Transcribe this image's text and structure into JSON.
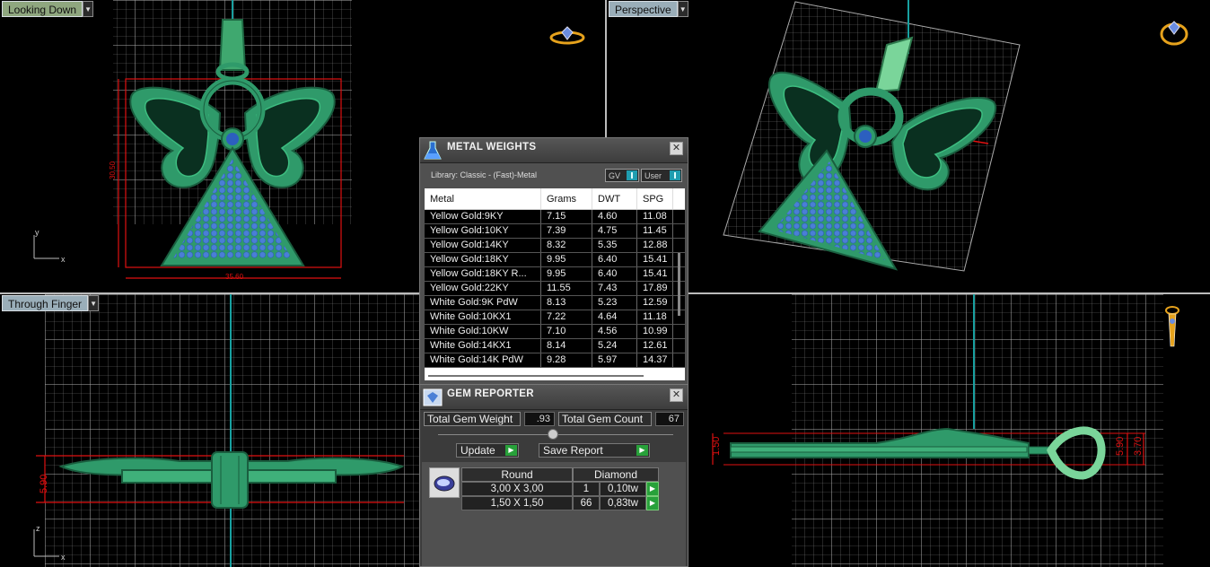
{
  "viewports": {
    "top": {
      "label": "Looking Down",
      "dim_width": "35.60",
      "dim_height": "30.50",
      "axis_a": "y",
      "axis_b": "x"
    },
    "perspective": {
      "label": "Perspective"
    },
    "finger": {
      "label": "Through Finger",
      "dim_height": "5.90",
      "axis_a": "z",
      "axis_b": "x"
    },
    "side": {
      "dim_left": "1.50",
      "dim_mid": "5.90",
      "dim_right": "3.70"
    }
  },
  "metal_weights": {
    "title": "METAL WEIGHTS",
    "library": "Library: Classic - (Fast)-Metal",
    "toggle_gv": "GV",
    "toggle_user": "User",
    "columns": [
      "Metal",
      "Grams",
      "DWT",
      "SPG"
    ],
    "rows": [
      {
        "metal": "Yellow Gold:9KY",
        "grams": "7.15",
        "dwt": "4.60",
        "spg": "11.08"
      },
      {
        "metal": "Yellow Gold:10KY",
        "grams": "7.39",
        "dwt": "4.75",
        "spg": "11.45"
      },
      {
        "metal": "Yellow Gold:14KY",
        "grams": "8.32",
        "dwt": "5.35",
        "spg": "12.88"
      },
      {
        "metal": "Yellow Gold:18KY",
        "grams": "9.95",
        "dwt": "6.40",
        "spg": "15.41"
      },
      {
        "metal": "Yellow Gold:18KY R...",
        "grams": "9.95",
        "dwt": "6.40",
        "spg": "15.41"
      },
      {
        "metal": "Yellow Gold:22KY",
        "grams": "11.55",
        "dwt": "7.43",
        "spg": "17.89"
      },
      {
        "metal": "White Gold:9K PdW",
        "grams": "8.13",
        "dwt": "5.23",
        "spg": "12.59"
      },
      {
        "metal": "White Gold:10KX1",
        "grams": "7.22",
        "dwt": "4.64",
        "spg": "11.18"
      },
      {
        "metal": "White Gold:10KW",
        "grams": "7.10",
        "dwt": "4.56",
        "spg": "10.99"
      },
      {
        "metal": "White Gold:14KX1",
        "grams": "8.14",
        "dwt": "5.24",
        "spg": "12.61"
      },
      {
        "metal": "White Gold:14K PdW",
        "grams": "9.28",
        "dwt": "5.97",
        "spg": "14.37"
      }
    ]
  },
  "gem_reporter": {
    "title": "GEM REPORTER",
    "total_weight_label": "Total Gem Weight",
    "total_weight_value": ".93",
    "total_count_label": "Total Gem Count",
    "total_count_value": "67",
    "update_label": "Update",
    "save_label": "Save Report",
    "shape": "Round",
    "material": "Diamond",
    "rows": [
      {
        "size": "3,00 X 3,00",
        "count": "1",
        "weight": "0,10tw"
      },
      {
        "size": "1,50 X 1,50",
        "count": "66",
        "weight": "0,83tw"
      }
    ]
  },
  "colors": {
    "model_green": "#2f9a6a",
    "gem_blue": "#4a7fd6",
    "dimension_red": "#e01010",
    "grid": "#8a8a8a"
  }
}
